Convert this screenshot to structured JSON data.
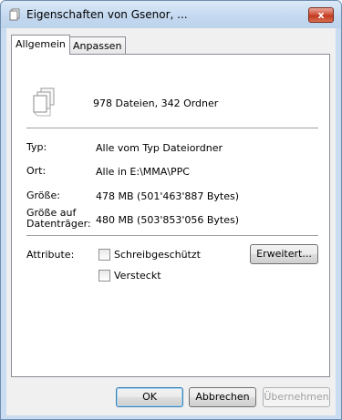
{
  "window": {
    "title": "Eigenschaften von Gsenor, ...",
    "close_label": "x"
  },
  "tabs": [
    {
      "label": "Allgemein",
      "active": true
    },
    {
      "label": "Anpassen",
      "active": false
    }
  ],
  "general": {
    "icon": "multiple-files-icon",
    "summary": "978 Dateien, 342 Ordner",
    "rows": {
      "type": {
        "label": "Typ:",
        "value": "Alle vom Typ Dateiordner"
      },
      "location": {
        "label": "Ort:",
        "value": "Alle in E:\\MMA\\PPC"
      },
      "size": {
        "label": "Größe:",
        "value": "478 MB (501'463'887 Bytes)"
      },
      "size_on_disk": {
        "label_line1": "Größe auf",
        "label_line2": "Datenträger:",
        "value": "480 MB (503'853'056 Bytes)"
      }
    },
    "attributes": {
      "label": "Attribute:",
      "readonly": {
        "label": "Schreibgeschützt",
        "checked": false
      },
      "hidden": {
        "label": "Versteckt",
        "checked": false
      },
      "advanced_button": "Erweitert..."
    }
  },
  "footer": {
    "ok": "OK",
    "cancel": "Abbrechen",
    "apply": "Übernehmen"
  }
}
